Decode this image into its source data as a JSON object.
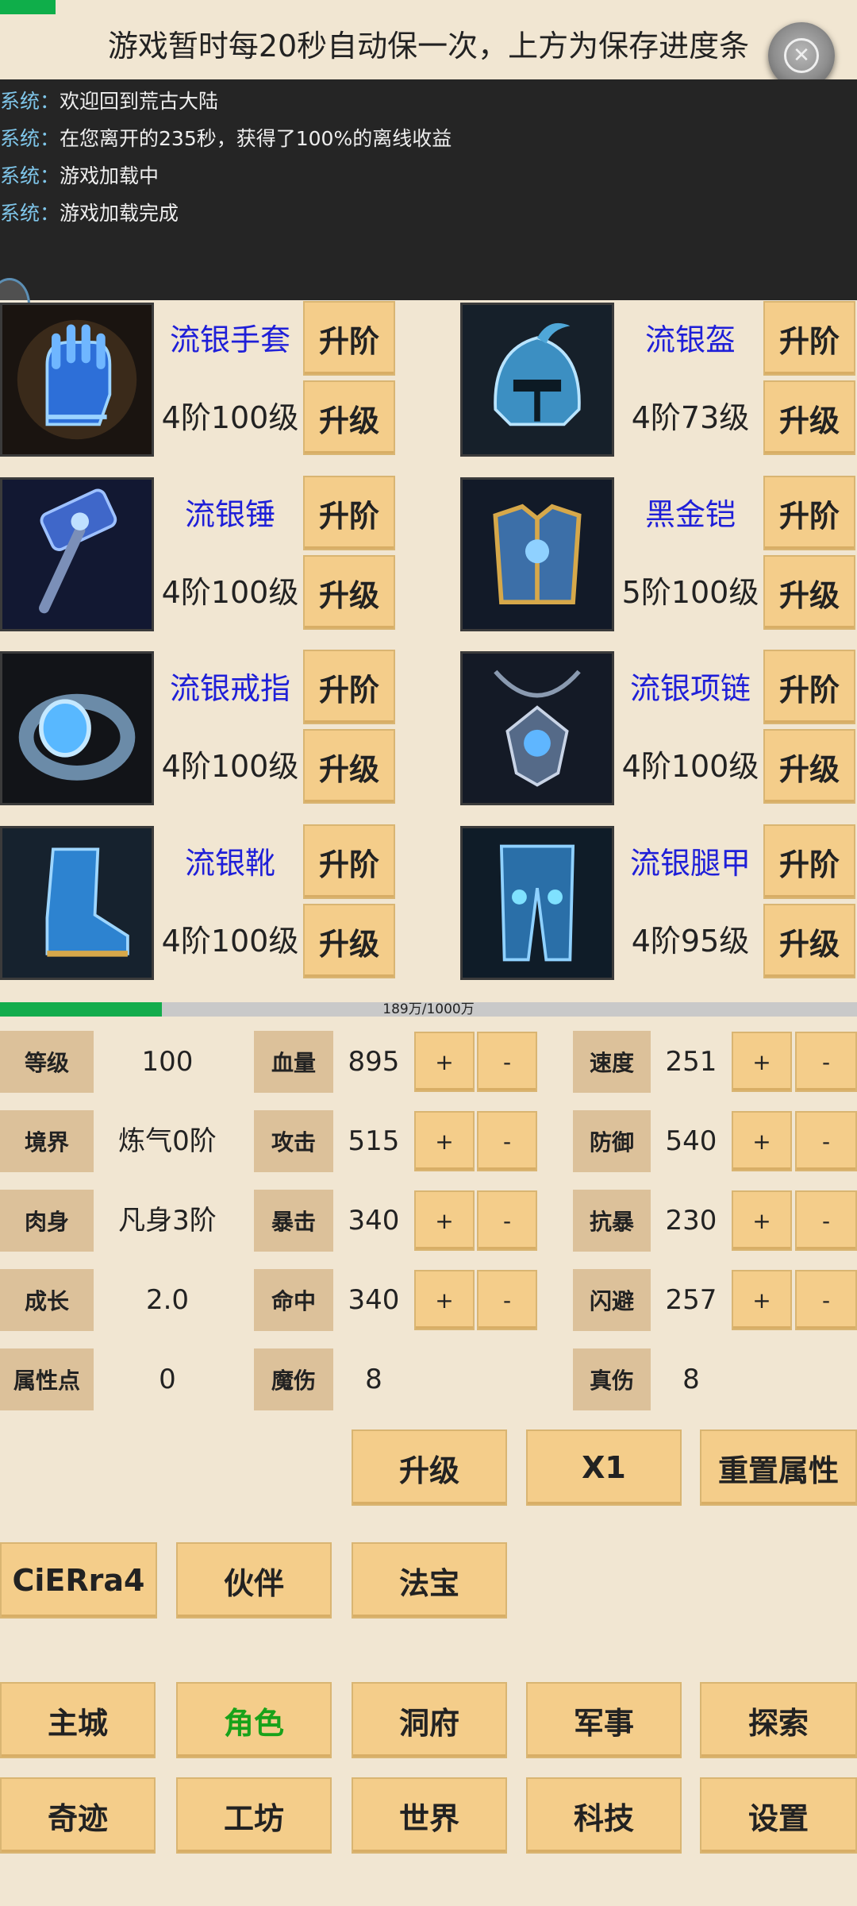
{
  "save_progress": 0.065,
  "notice": "游戏暂时每20秒自动保一次，上方为保存进度条",
  "log": [
    {
      "who": "系统：",
      "msg": "欢迎回到荒古大陆"
    },
    {
      "who": "系统：",
      "msg": "在您离开的235秒，获得了100%的离线收益"
    },
    {
      "who": "系统：",
      "msg": "游戏加载中"
    },
    {
      "who": "系统：",
      "msg": "游戏加载完成"
    }
  ],
  "equipment": [
    {
      "name": "流银手套",
      "level": "4阶100级",
      "icon": "gauntlet-icon",
      "advance": "升阶",
      "upgrade": "升级"
    },
    {
      "name": "流银盔",
      "level": "4阶73级",
      "icon": "helmet-icon",
      "advance": "升阶",
      "upgrade": "升级"
    },
    {
      "name": "流银锤",
      "level": "4阶100级",
      "icon": "hammer-icon",
      "advance": "升阶",
      "upgrade": "升级"
    },
    {
      "name": "黑金铠",
      "level": "5阶100级",
      "icon": "armor-icon",
      "advance": "升阶",
      "upgrade": "升级"
    },
    {
      "name": "流银戒指",
      "level": "4阶100级",
      "icon": "ring-icon",
      "advance": "升阶",
      "upgrade": "升级"
    },
    {
      "name": "流银项链",
      "level": "4阶100级",
      "icon": "necklace-icon",
      "advance": "升阶",
      "upgrade": "升级"
    },
    {
      "name": "流银靴",
      "level": "4阶100级",
      "icon": "boots-icon",
      "advance": "升阶",
      "upgrade": "升级"
    },
    {
      "name": "流银腿甲",
      "level": "4阶95级",
      "icon": "leggings-icon",
      "advance": "升阶",
      "upgrade": "升级"
    }
  ],
  "xp": {
    "text": "189万/1000万",
    "fraction": 0.189
  },
  "stats": {
    "left": [
      {
        "label": "等级",
        "value": "100"
      },
      {
        "label": "境界",
        "value": "炼气0阶"
      },
      {
        "label": "肉身",
        "value": "凡身3阶"
      },
      {
        "label": "成长",
        "value": "2.0"
      },
      {
        "label": "属性点",
        "value": "0"
      }
    ],
    "mid": [
      {
        "label": "血量",
        "value": "895"
      },
      {
        "label": "攻击",
        "value": "515"
      },
      {
        "label": "暴击",
        "value": "340"
      },
      {
        "label": "命中",
        "value": "340"
      },
      {
        "label": "魔伤",
        "value": "8"
      }
    ],
    "right": [
      {
        "label": "速度",
        "value": "251"
      },
      {
        "label": "防御",
        "value": "540"
      },
      {
        "label": "抗暴",
        "value": "230"
      },
      {
        "label": "闪避",
        "value": "257"
      },
      {
        "label": "真伤",
        "value": "8"
      }
    ],
    "plus": "+",
    "minus": "-"
  },
  "actions": {
    "upgrade": "升级",
    "multiplier": "X1",
    "reset": "重置属性"
  },
  "character_tabs": [
    "CiERra4",
    "伙伴",
    "法宝"
  ],
  "nav": {
    "row1": [
      "主城",
      "角色",
      "洞府",
      "军事",
      "探索"
    ],
    "row2": [
      "奇迹",
      "工坊",
      "世界",
      "科技",
      "设置"
    ],
    "active": "角色",
    "active_color": "#18a21a"
  }
}
